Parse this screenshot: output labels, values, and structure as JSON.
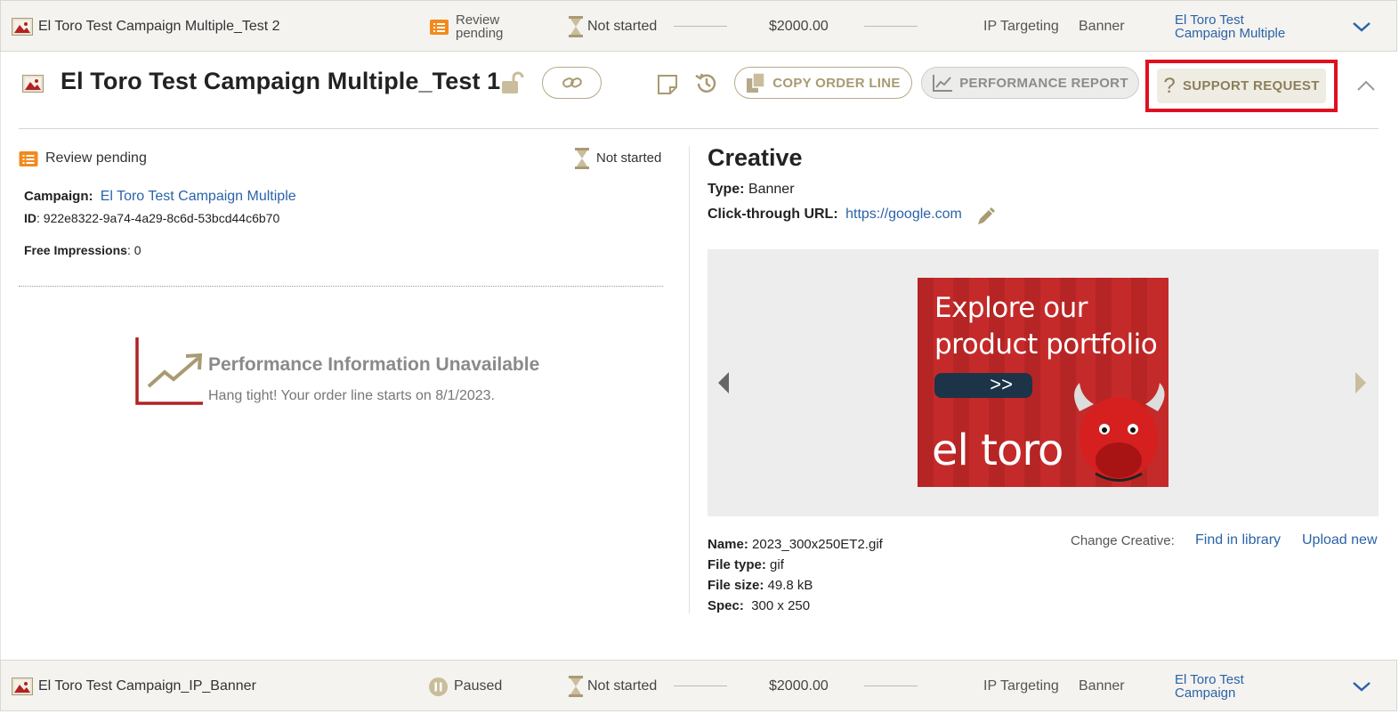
{
  "rows": {
    "top": {
      "name": "El Toro Test Campaign Multiple_Test 2",
      "review_line1": "Review",
      "review_line2": "pending",
      "status": "Not started",
      "budget": "$2000.00",
      "targeting": "IP Targeting",
      "type": "Banner",
      "campaign_line1": "El Toro Test",
      "campaign_line2": "Campaign Multiple"
    },
    "bottom": {
      "name": "El Toro Test Campaign_IP_Banner",
      "state": "Paused",
      "status": "Not started",
      "budget": "$2000.00",
      "targeting": "IP Targeting",
      "type": "Banner",
      "campaign_line1": "El Toro Test",
      "campaign_line2": "Campaign"
    }
  },
  "expanded": {
    "title": "El Toro Test Campaign Multiple_Test 1",
    "copy_label": "COPY ORDER LINE",
    "perf_label": "PERFORMANCE REPORT",
    "support_label": "SUPPORT REQUEST",
    "review_status": "Review pending",
    "run_status": "Not started",
    "campaign_label": "Campaign:",
    "campaign_value": "El Toro Test Campaign Multiple",
    "id_label": "ID",
    "id_value": ": 922e8322-9a74-4a29-8c6d-53bcd44c6b70",
    "free_label": "Free Impressions",
    "free_value": ": 0",
    "perf_title": "Performance Information Unavailable",
    "perf_sub": "Hang tight! Your order line starts on 8/1/2023."
  },
  "creative": {
    "heading": "Creative",
    "type_label": "Type:",
    "type_value": "Banner",
    "url_label": "Click-through URL:",
    "url_value": "https://google.com",
    "banner_line1": "Explore our",
    "banner_line2": "product portfolio",
    "banner_button": ">>",
    "banner_brand": "el toro",
    "name_label": "Name:",
    "name_value": "2023_300x250ET2.gif",
    "filetype_label": "File type:",
    "filetype_value": "gif",
    "filesize_label": "File size:",
    "filesize_value": "49.8 kB",
    "spec_label": "Spec:",
    "spec_value": "300 x 250",
    "change_label": "Change Creative:",
    "find_label": "Find in library",
    "upload_label": "Upload new"
  },
  "colors": {
    "accent_gold": "#a99a72",
    "link_blue": "#2b63a8",
    "review_orange": "#f28a1c",
    "highlight_red": "#e01020",
    "chart_red": "#b22222"
  }
}
